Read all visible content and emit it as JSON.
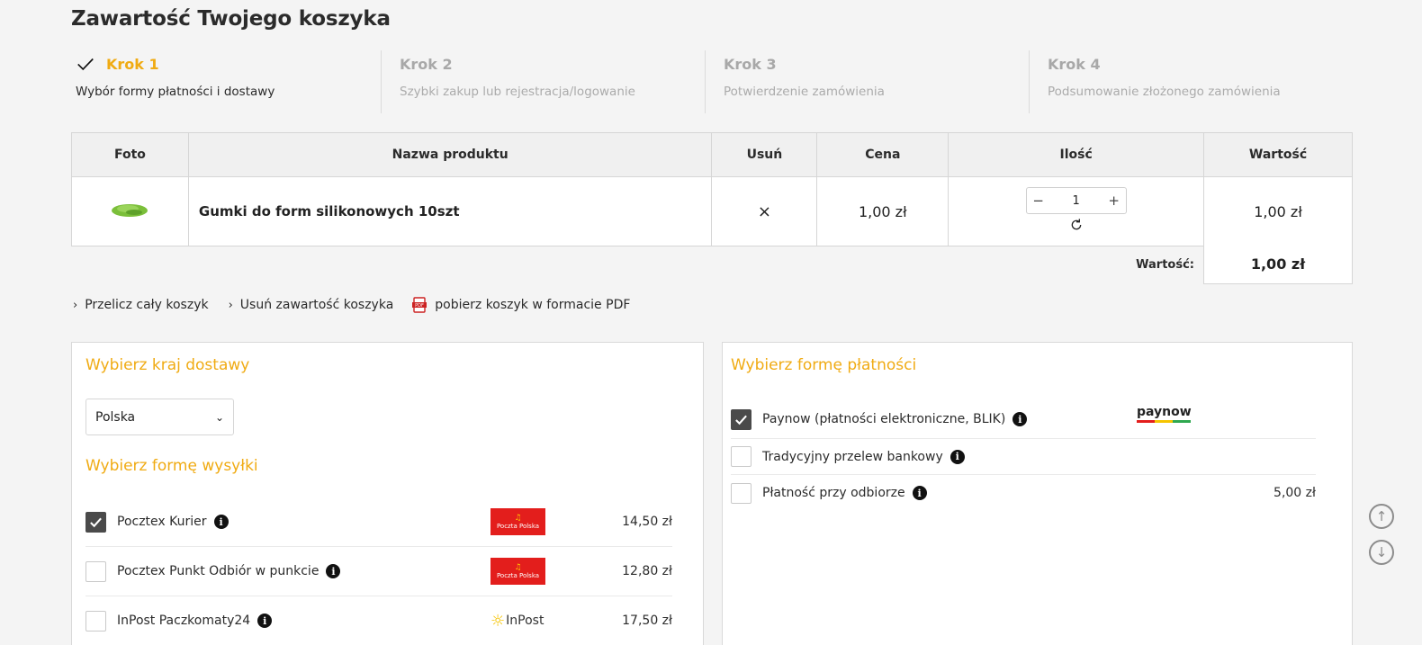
{
  "page_title": "Zawartość Twojego koszyka",
  "steps": [
    {
      "label": "Krok 1",
      "sub": "Wybór formy płatności i dostawy",
      "active": true
    },
    {
      "label": "Krok 2",
      "sub": "Szybki zakup lub rejestracja/logowanie"
    },
    {
      "label": "Krok 3",
      "sub": "Potwierdzenie zamówienia"
    },
    {
      "label": "Krok 4",
      "sub": "Podsumowanie złożonego zamówienia"
    }
  ],
  "table": {
    "headers": [
      "Foto",
      "Nazwa produktu",
      "Usuń",
      "Cena",
      "Ilość",
      "Wartość"
    ],
    "rows": [
      {
        "name": "Gumki do form silikonowych 10szt",
        "remove": "×",
        "price": "1,00 zł",
        "qty": "1",
        "value": "1,00 zł"
      }
    ],
    "qty_minus": "−",
    "qty_plus": "+",
    "total_label": "Wartość:",
    "total_value": "1,00 zł"
  },
  "links": {
    "recalc": "Przelicz cały koszyk",
    "clear": "Usuń zawartość koszyka",
    "pdf": "pobierz koszyk w formacie PDF"
  },
  "delivery": {
    "country_heading": "Wybierz kraj dostawy",
    "country_selected": "Polska",
    "shipping_heading": "Wybierz formę wysyłki",
    "options": [
      {
        "label": "Pocztex Kurier",
        "price": "14,50 zł",
        "checked": true,
        "logo": "poczta-polska"
      },
      {
        "label": "Pocztex Punkt Odbiór w punkcie",
        "price": "12,80 zł",
        "checked": false,
        "logo": "poczta-polska"
      },
      {
        "label": "InPost Paczkomaty24",
        "price": "17,50 zł",
        "checked": false,
        "logo": "inpost"
      }
    ],
    "pp_logo_text": "Poczta Polska",
    "inpost_logo_text": "InPost"
  },
  "payment": {
    "heading": "Wybierz formę płatności",
    "options": [
      {
        "label": "Paynow (płatności elektroniczne, BLIK)",
        "price": "",
        "checked": true
      },
      {
        "label": "Tradycyjny przelew bankowy",
        "price": "",
        "checked": false
      },
      {
        "label": "Płatność przy odbiorze",
        "price": "5,00 zł",
        "checked": false
      }
    ],
    "paynow_logo_text": "paynow"
  },
  "colors": {
    "accent": "#f0ab13",
    "checked": "#4a4a4a",
    "poczta_red": "#e31e1c"
  },
  "icons": [
    "check-icon",
    "close-icon",
    "refresh-icon",
    "chevron-right-icon",
    "pdf-icon",
    "chevron-down-icon",
    "info-icon",
    "arrow-up-icon",
    "arrow-down-icon"
  ]
}
